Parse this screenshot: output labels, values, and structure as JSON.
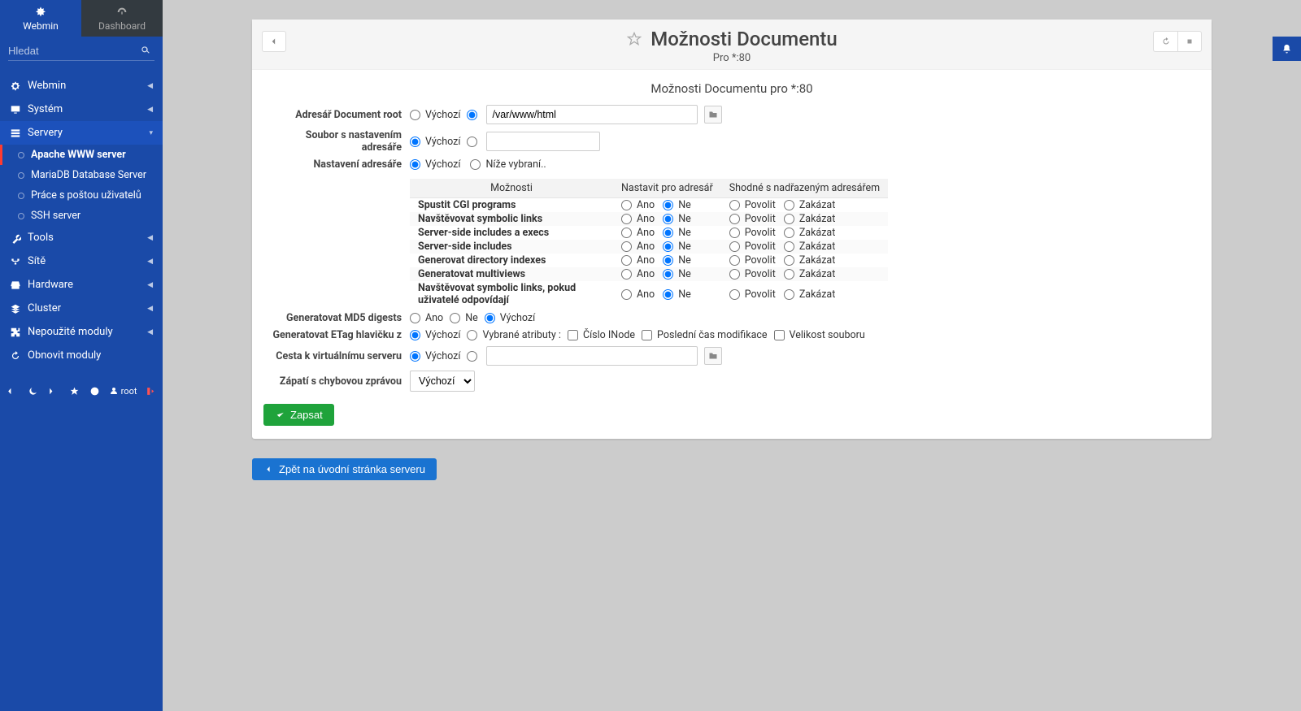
{
  "tabs": {
    "webmin": "Webmin",
    "dashboard": "Dashboard"
  },
  "search": {
    "placeholder": "Hledat"
  },
  "nav": {
    "webmin": "Webmin",
    "system": "Systém",
    "servery": "Servery",
    "servery_items": {
      "apache": "Apache WWW server",
      "mariadb": "MariaDB Database Server",
      "mail": "Práce s poštou uživatelů",
      "ssh": "SSH server"
    },
    "tools": "Tools",
    "site": "Sítě",
    "hardware": "Hardware",
    "cluster": "Cluster",
    "unused": "Nepoužité moduly",
    "refresh": "Obnovit moduly"
  },
  "user": "root",
  "page": {
    "title": "Možnosti Documentu",
    "subtitle": "Pro *:80",
    "section": "Možnosti Documentu pro *:80",
    "labels": {
      "docroot": "Adresář Document root",
      "cfgfile": "Soubor s nastavením adresáře",
      "diropts": "Nastavení adresáře",
      "md5": "Generatovat MD5 digests",
      "etag": "Generatovat ETag hlavičku z",
      "virtpath": "Cesta k virtuálnímu serveru",
      "footer": "Zápatí s chybovou zprávou"
    },
    "values": {
      "default": "Výchozí",
      "docroot_path": "/var/www/html",
      "below_selected": "Níže vybraní..",
      "ano": "Ano",
      "ne": "Ne",
      "povolit": "Povolit",
      "zakazat": "Zakázat",
      "selected_attrs": "Vybrané atributy :",
      "inode": "Číslo INode",
      "mtime": "Poslední čas modifikace",
      "size": "Velikost souboru"
    },
    "table": {
      "h_option": "Možnosti",
      "h_set": "Nastavit pro adresář",
      "h_same": "Shodné s nadřazeným adresářem",
      "rows": [
        "Spustit CGI programs",
        "Navštěvovat symbolic links",
        "Server-side includes a execs",
        "Server-side includes",
        "Generovat directory indexes",
        "Generatovat multiviews",
        "Navštěvovat symbolic links, pokud uživatelé odpovídají"
      ]
    },
    "buttons": {
      "save": "Zapsat",
      "back": "Zpět na úvodní stránka serveru"
    },
    "select_default": "Výchozí"
  }
}
